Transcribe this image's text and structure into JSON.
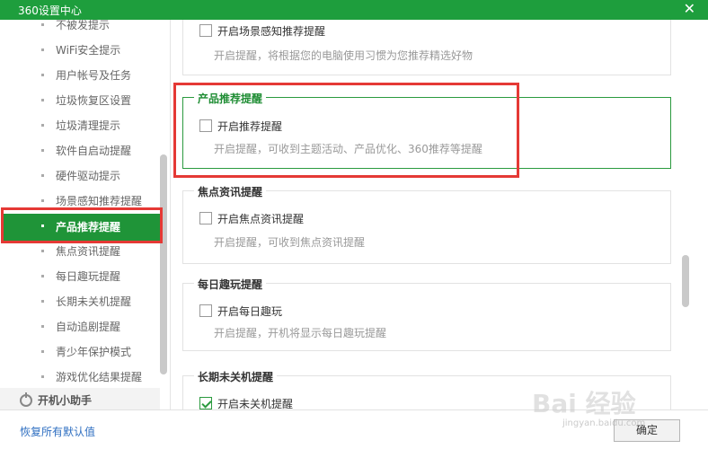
{
  "window": {
    "title": "360设置中心",
    "close_glyph": "✕"
  },
  "sidebar": {
    "items": [
      {
        "label": "不被发提示"
      },
      {
        "label": "WiFi安全提示"
      },
      {
        "label": "用户帐号及任务"
      },
      {
        "label": "垃圾恢复区设置"
      },
      {
        "label": "垃圾清理提示"
      },
      {
        "label": "软件自启动提醒"
      },
      {
        "label": "硬件驱动提示"
      },
      {
        "label": "场景感知推荐提醒"
      },
      {
        "label": "产品推荐提醒",
        "active": true
      },
      {
        "label": "焦点资讯提醒"
      },
      {
        "label": "每日趣玩提醒"
      },
      {
        "label": "长期未关机提醒"
      },
      {
        "label": "自动追剧提醒"
      },
      {
        "label": "青少年保护模式"
      },
      {
        "label": "游戏优化结果提醒"
      }
    ],
    "section": {
      "label": "开机小助手",
      "icon": "power-icon"
    }
  },
  "groups": [
    {
      "title": "",
      "checkbox_label": "开启场景感知推荐提醒",
      "checked": false,
      "desc": "开启提醒，将根据您的电脑使用习惯为您推荐精选好物"
    },
    {
      "title": "产品推荐提醒",
      "checkbox_label": "开启推荐提醒",
      "checked": false,
      "desc": "开启提醒，可收到主题活动、产品优化、360推荐等提醒"
    },
    {
      "title": "焦点资讯提醒",
      "checkbox_label": "开启焦点资讯提醒",
      "checked": false,
      "desc": "开启提醒，可收到焦点资讯提醒"
    },
    {
      "title": "每日趣玩提醒",
      "checkbox_label": "开启每日趣玩",
      "checked": false,
      "desc": "开启提醒，开机将显示每日趣玩提醒"
    },
    {
      "title": "长期未关机提醒",
      "checkbox_label": "开启未关机提醒",
      "checked": true,
      "desc": ""
    }
  ],
  "footer": {
    "restore_label": "恢复所有默认值",
    "ok_label": "确定"
  },
  "watermark": {
    "text": "Bai 经验",
    "sub": "jingyan.baidu.com"
  },
  "colors": {
    "brand_green": "#1e9e3d",
    "highlight_red": "#e53935",
    "link_blue": "#2f6fc1"
  }
}
